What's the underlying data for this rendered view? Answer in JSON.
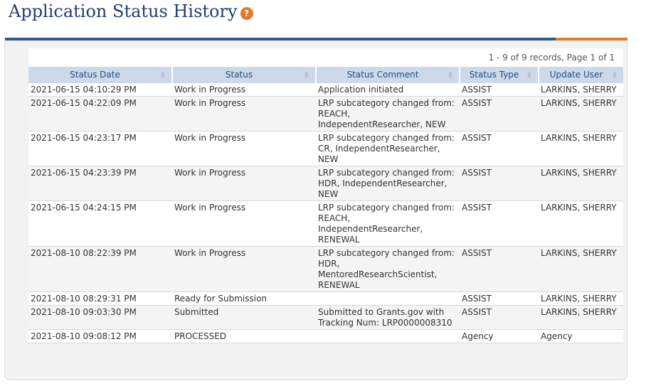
{
  "page": {
    "title": "Application Status History",
    "help_icon_glyph": "?"
  },
  "colors": {
    "title": "#1f3f6e",
    "accent_blue": "#2d5b8c",
    "accent_orange": "#e07a2c",
    "header_bg": "#cdd9e9",
    "header_text": "#1f4d8a"
  },
  "table": {
    "records_info": "1 - 9 of 9 records, Page 1 of 1",
    "columns": [
      {
        "label": "Status Date",
        "icon": "sort-icon"
      },
      {
        "label": "Status",
        "icon": "sort-icon"
      },
      {
        "label": "Status Comment",
        "icon": "sort-icon"
      },
      {
        "label": "Status Type",
        "icon": "sort-icon"
      },
      {
        "label": "Update User",
        "icon": "sort-icon"
      }
    ],
    "rows": [
      {
        "date": "2021-06-15 04:10:29 PM",
        "status": "Work in Progress",
        "comment": "Application initiated",
        "type": "ASSIST",
        "user": "LARKINS, SHERRY"
      },
      {
        "date": "2021-06-15 04:22:09 PM",
        "status": "Work in Progress",
        "comment": "LRP subcategory changed from: REACH, IndependentResearcher, NEW",
        "type": "ASSIST",
        "user": "LARKINS, SHERRY"
      },
      {
        "date": "2021-06-15 04:23:17 PM",
        "status": "Work in Progress",
        "comment": "LRP subcategory changed from: CR, IndependentResearcher, NEW",
        "type": "ASSIST",
        "user": "LARKINS, SHERRY"
      },
      {
        "date": "2021-06-15 04:23:39 PM",
        "status": "Work in Progress",
        "comment": "LRP subcategory changed from: HDR, IndependentResearcher, NEW",
        "type": "ASSIST",
        "user": "LARKINS, SHERRY"
      },
      {
        "date": "2021-06-15 04:24:15 PM",
        "status": "Work in Progress",
        "comment": "LRP subcategory changed from: REACH, IndependentResearcher, RENEWAL",
        "type": "ASSIST",
        "user": "LARKINS, SHERRY"
      },
      {
        "date": "2021-08-10 08:22:39 PM",
        "status": "Work in Progress",
        "comment": "LRP subcategory changed from: HDR, MentoredResearchScientist, RENEWAL",
        "type": "ASSIST",
        "user": "LARKINS, SHERRY"
      },
      {
        "date": "2021-08-10 08:29:31 PM",
        "status": "Ready for Submission",
        "comment": "",
        "type": "ASSIST",
        "user": "LARKINS, SHERRY"
      },
      {
        "date": "2021-08-10 09:03:30 PM",
        "status": "Submitted",
        "comment": "Submitted to Grants.gov with Tracking Num: LRP0000008310",
        "type": "ASSIST",
        "user": "LARKINS, SHERRY"
      },
      {
        "date": "2021-08-10 09:08:12 PM",
        "status": "PROCESSED",
        "comment": "",
        "type": "Agency",
        "user": "Agency"
      }
    ]
  }
}
